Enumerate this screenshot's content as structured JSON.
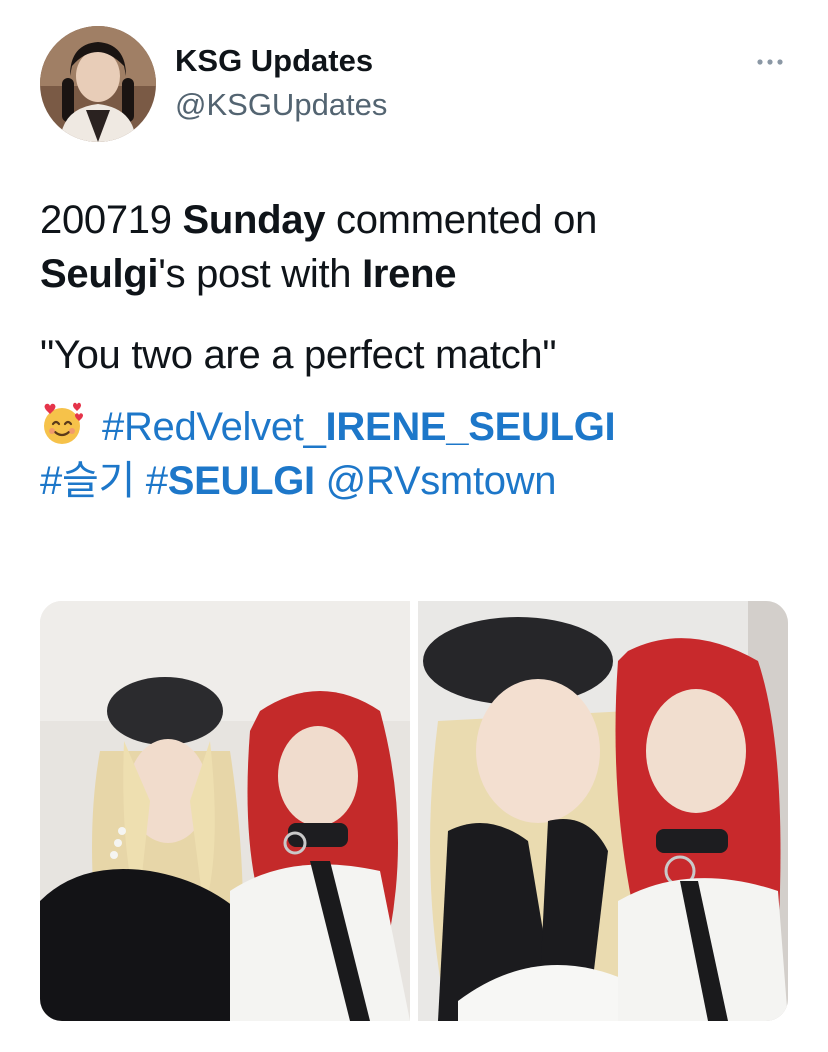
{
  "author": {
    "display_name": "KSG Updates",
    "handle": "@KSGUpdates",
    "avatar_icon": "profile-photo"
  },
  "more_icon": "more-dots-icon",
  "tweet": {
    "line1": {
      "date": "200719",
      "name1": "Sunday",
      "verb": "commented on"
    },
    "line2": {
      "name2": "Seulgi",
      "possessive": "'s post with",
      "name3": "Irene"
    },
    "quote": "\"You two are a perfect match\"",
    "emoji": "smiling-face-with-hearts",
    "hashtag1_prefix": "#RedVelvet_",
    "hashtag1_bold": "IRENE_SEULGI",
    "hashtag2": "#슬기",
    "hashtag3_prefix": "#",
    "hashtag3_bold": "SEULGI",
    "mention": "@RVsmtown"
  },
  "colors": {
    "link": "#1d77c9",
    "secondary_text": "#536471",
    "primary_text": "#0f1419"
  },
  "media": [
    {
      "name": "photo-1",
      "description": "two-women-selfie-left"
    },
    {
      "name": "photo-2",
      "description": "two-women-selfie-right"
    }
  ]
}
